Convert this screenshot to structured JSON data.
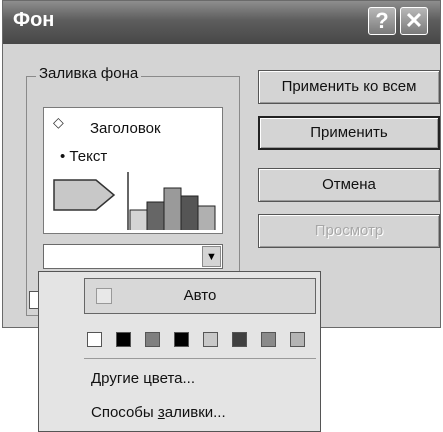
{
  "window": {
    "title": "Фон",
    "help_glyph": "?",
    "close_glyph": "✕"
  },
  "fill_group": {
    "label": "Заливка фона",
    "preview": {
      "heading": "Заголовок",
      "bullet": "• Текст",
      "heading_marker_icon": "diamond-icon"
    }
  },
  "buttons": {
    "apply_all": "Применить ко всем",
    "apply": "Применить",
    "cancel": "Отмена",
    "preview": "Просмотр"
  },
  "dropdown": {
    "auto_label": "Авто",
    "swatch_colors": [
      "#ffffff",
      "#000000",
      "#7f7f7f",
      "#000000",
      "#c8c8c8",
      "#404040",
      "#8a8a8a",
      "#b4b4b4"
    ],
    "more_colors": {
      "pre": "",
      "ul": "Д",
      "post": "ругие цвета..."
    },
    "fill_effects": {
      "pre": "Способы ",
      "ul": "з",
      "post": "аливки..."
    }
  },
  "colors": {
    "bar_colors": [
      "#d4d4d4",
      "#666666",
      "#9a9a9a",
      "#555555",
      "#b0b0b0"
    ],
    "arrow_fill": "#c8c8c8"
  }
}
